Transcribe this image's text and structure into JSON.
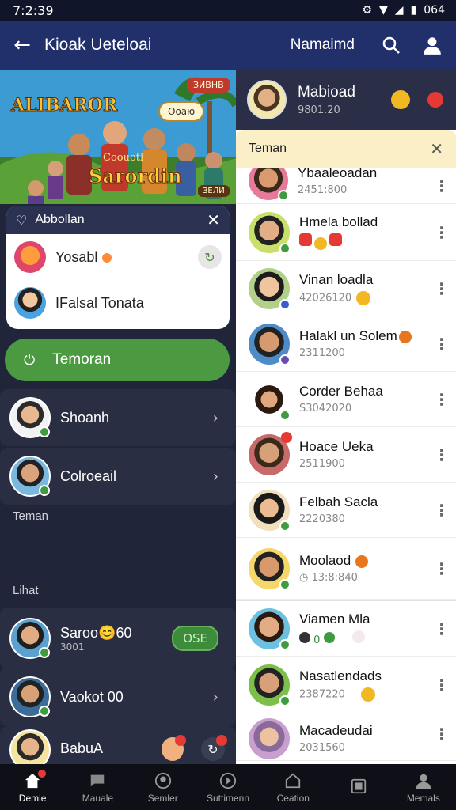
{
  "status": {
    "time": "7:2:39",
    "battery": "064"
  },
  "appbar": {
    "title": "Kioak Ueteloai",
    "user": "Namaimd"
  },
  "banner": {
    "title_top": "ALIBAROR",
    "title_bottom": "Sarordin",
    "subtitle": "Coouotl",
    "tag_top": "ЗИВНВ",
    "tag_mid": "Ооаю",
    "tag_bottom": "ЗЕЛИ"
  },
  "card": {
    "title": "Abbollan",
    "rows": [
      {
        "name": "Yosabl"
      },
      {
        "name": "IFalsal Tonata"
      }
    ]
  },
  "start_button": {
    "label": "Temoran"
  },
  "left_rows": [
    {
      "name": "Shoanh"
    },
    {
      "name": "Colroeail"
    }
  ],
  "sections": {
    "friends": "Teman",
    "list": "Lihat"
  },
  "left_list": [
    {
      "name": "Saroo😊60",
      "sub": "3001",
      "pill": "OSE"
    },
    {
      "name": "Vaokot 00"
    },
    {
      "name": "BabuA"
    }
  ],
  "right_top": {
    "name": "Mabioad",
    "sub": "9801.20"
  },
  "friends_tab": {
    "label": "Teman"
  },
  "friends": [
    {
      "name": "Ybaaleoadan",
      "sub": "2451:800"
    },
    {
      "name": "Hmela bollad",
      "sub": ""
    },
    {
      "name": "Vinan loadla",
      "sub": "42026120"
    },
    {
      "name": "Halakl un Solem",
      "sub": "2311200"
    },
    {
      "name": "Corder Behaa",
      "sub": "S3042020"
    },
    {
      "name": "Hoace Ueka",
      "sub": "2511900"
    },
    {
      "name": "Felbah Sacla",
      "sub": "2220380"
    },
    {
      "name": "Moolaod",
      "sub": "13:8:840"
    },
    {
      "name": "Viamen Mla",
      "sub": "0"
    },
    {
      "name": "Nasatlendads",
      "sub": "2387220"
    },
    {
      "name": "Macadeudai",
      "sub": "2031560"
    }
  ],
  "bottom_nav": [
    {
      "label": "Demle"
    },
    {
      "label": "Mauale"
    },
    {
      "label": "Semler"
    },
    {
      "label": "Suttimenn"
    },
    {
      "label": "Ceation"
    },
    {
      "label": ""
    },
    {
      "label": "Memals"
    }
  ],
  "colors": {
    "appbar": "#21306b",
    "accent_green": "#4b9a42",
    "panel_dark": "#21253a",
    "tab_header": "#fbefc8"
  }
}
